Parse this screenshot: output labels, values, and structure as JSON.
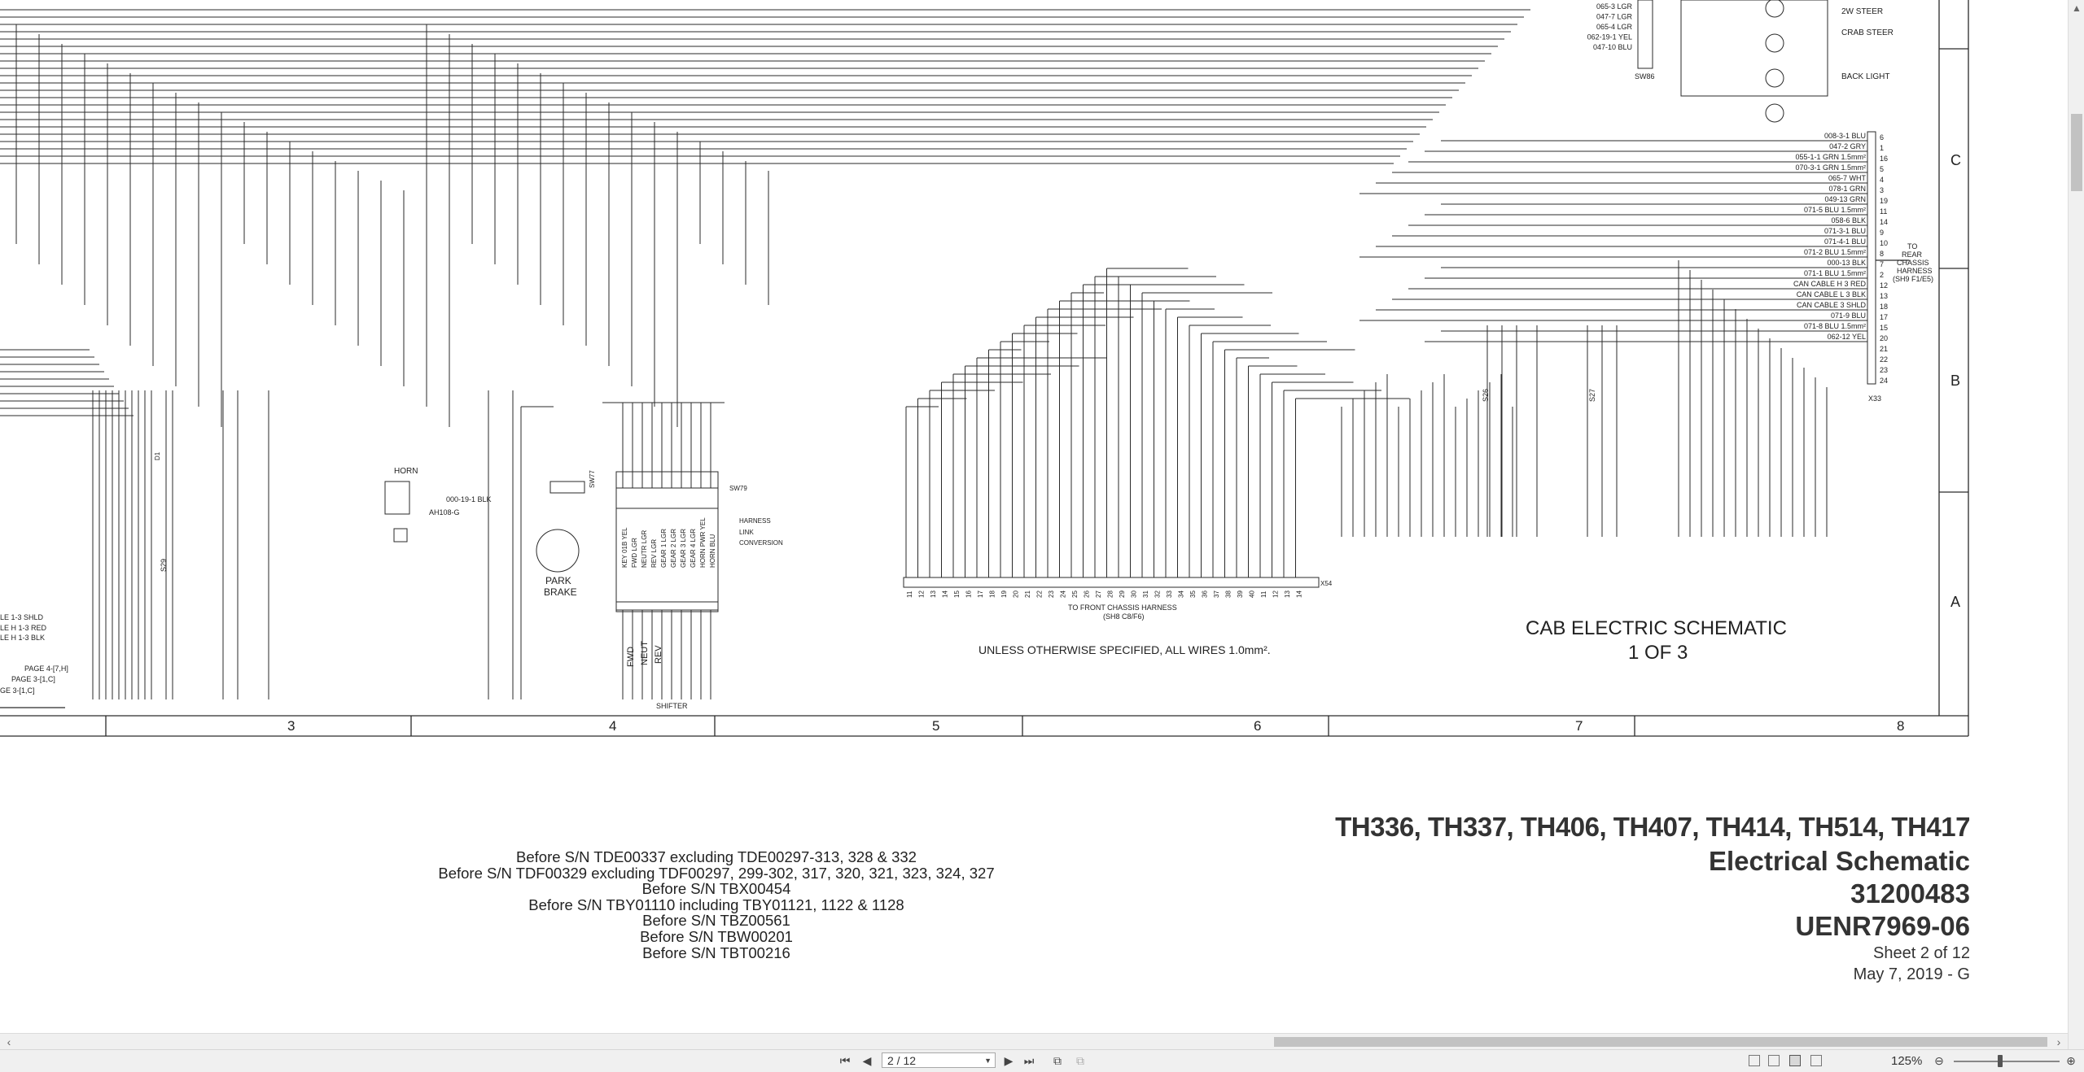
{
  "schematic": {
    "top_labels": [
      "065-3 LGR",
      "047-7 LGR",
      "065-4 LGR",
      "062-19-1 YEL",
      "047-10 BLU"
    ],
    "switch_label": "SW86",
    "steer_modes": [
      "2W STEER",
      "CRAB STEER",
      "BACK LIGHT"
    ],
    "zone_letters": [
      "C",
      "B",
      "A"
    ],
    "rear_connector_wires": [
      "008-3-1 BLU",
      "047-2 GRY",
      "055-1-1 GRN 1.5mm²",
      "070-3-1 GRN 1.5mm²",
      "065-7 WHT",
      "078-1 GRN",
      "049-13 GRN",
      "071-5 BLU 1.5mm²",
      "058-6 BLK",
      "071-3-1 BLU",
      "071-4-1 BLU",
      "071-2 BLU 1.5mm²",
      "000-13 BLK",
      "071-1 BLU 1.5mm²",
      "CAN CABLE H 3 RED",
      "CAN CABLE L 3 BLK",
      "CAN CABLE 3 SHLD",
      "071-9 BLU",
      "071-8 BLU 1.5mm²",
      "062-12 YEL"
    ],
    "rear_connector_pins": [
      "6",
      "1",
      "16",
      "5",
      "4",
      "3",
      "19",
      "11",
      "14",
      "9",
      "10",
      "8",
      "7",
      "2",
      "12",
      "13",
      "18",
      "17",
      "15",
      "20",
      "21",
      "22",
      "23",
      "24"
    ],
    "rear_connector_label": "X33",
    "to_rear_label": [
      "TO",
      "REAR",
      "CHASSIS",
      "HARNESS",
      "(SH9 F1/E5)"
    ],
    "horn_label": "HORN",
    "horn_conn": "AH108-G",
    "horn_wire": "000-19-1 BLK",
    "horn_ref": "AH108",
    "park_brake_label": [
      "PARK",
      "BRAKE"
    ],
    "park_brake_sw": "SW77",
    "shifter_label": "SHIFTER",
    "shifter_positions": [
      "FWD",
      "NEUT",
      "REV"
    ],
    "harness_note": [
      "HARNESS",
      "LINK",
      "CONVERSION"
    ],
    "sw79": "SW79",
    "key_wires": [
      "KEY 01B YEL",
      "FWD LGR",
      "NEUTR LGR",
      "REV LGR",
      "GEAR 1 LGR",
      "GEAR 2 LGR",
      "GEAR 3 LGR",
      "GEAR 4 LGR",
      "HORN PWR YEL",
      "HORN BLU"
    ],
    "front_chassis_label": [
      "TO FRONT CHASSIS HARNESS",
      "(SH8 C8/F6)"
    ],
    "front_connector": "X54",
    "wires_note": "UNLESS OTHERWISE SPECIFIED, ALL WIRES 1.0mm².",
    "cab_title": [
      "CAB ELECTRIC SCHEMATIC",
      "1 OF 3"
    ],
    "left_labels": [
      "LE 1-3 SHLD",
      "LE H 1-3 RED",
      "LE H 1-3 BLK",
      "PAGE 4-[7,H]",
      "PAGE 3-[1,C]",
      "GE 3-[1,C]"
    ],
    "diode_label": "D1",
    "s29": "S29",
    "s26": "S26",
    "s27": "S27",
    "column_numbers": [
      "3",
      "4",
      "5",
      "6",
      "7",
      "8"
    ]
  },
  "serials": [
    "Before S/N TDE00337 excluding TDE00297-313, 328 & 332",
    "Before S/N TDF00329 excluding TDF00297, 299-302, 317, 320, 321, 323, 324, 327",
    "Before S/N TBX00454",
    "Before S/N TBY01110 including TBY01121, 1122 & 1128",
    "Before S/N TBZ00561",
    "Before S/N TBW00201",
    "Before S/N TBT00216"
  ],
  "titleblock": {
    "models": "TH336, TH337, TH406, TH407, TH414, TH514, TH417",
    "doc_type": "Electrical Schematic",
    "part_number": "31200483",
    "doc_number": "UENR7969-06",
    "sheet": "Sheet 2 of 12",
    "date": "May 7, 2019 - G"
  },
  "statusbar": {
    "page_field": "2 / 12",
    "zoom": "125%"
  }
}
